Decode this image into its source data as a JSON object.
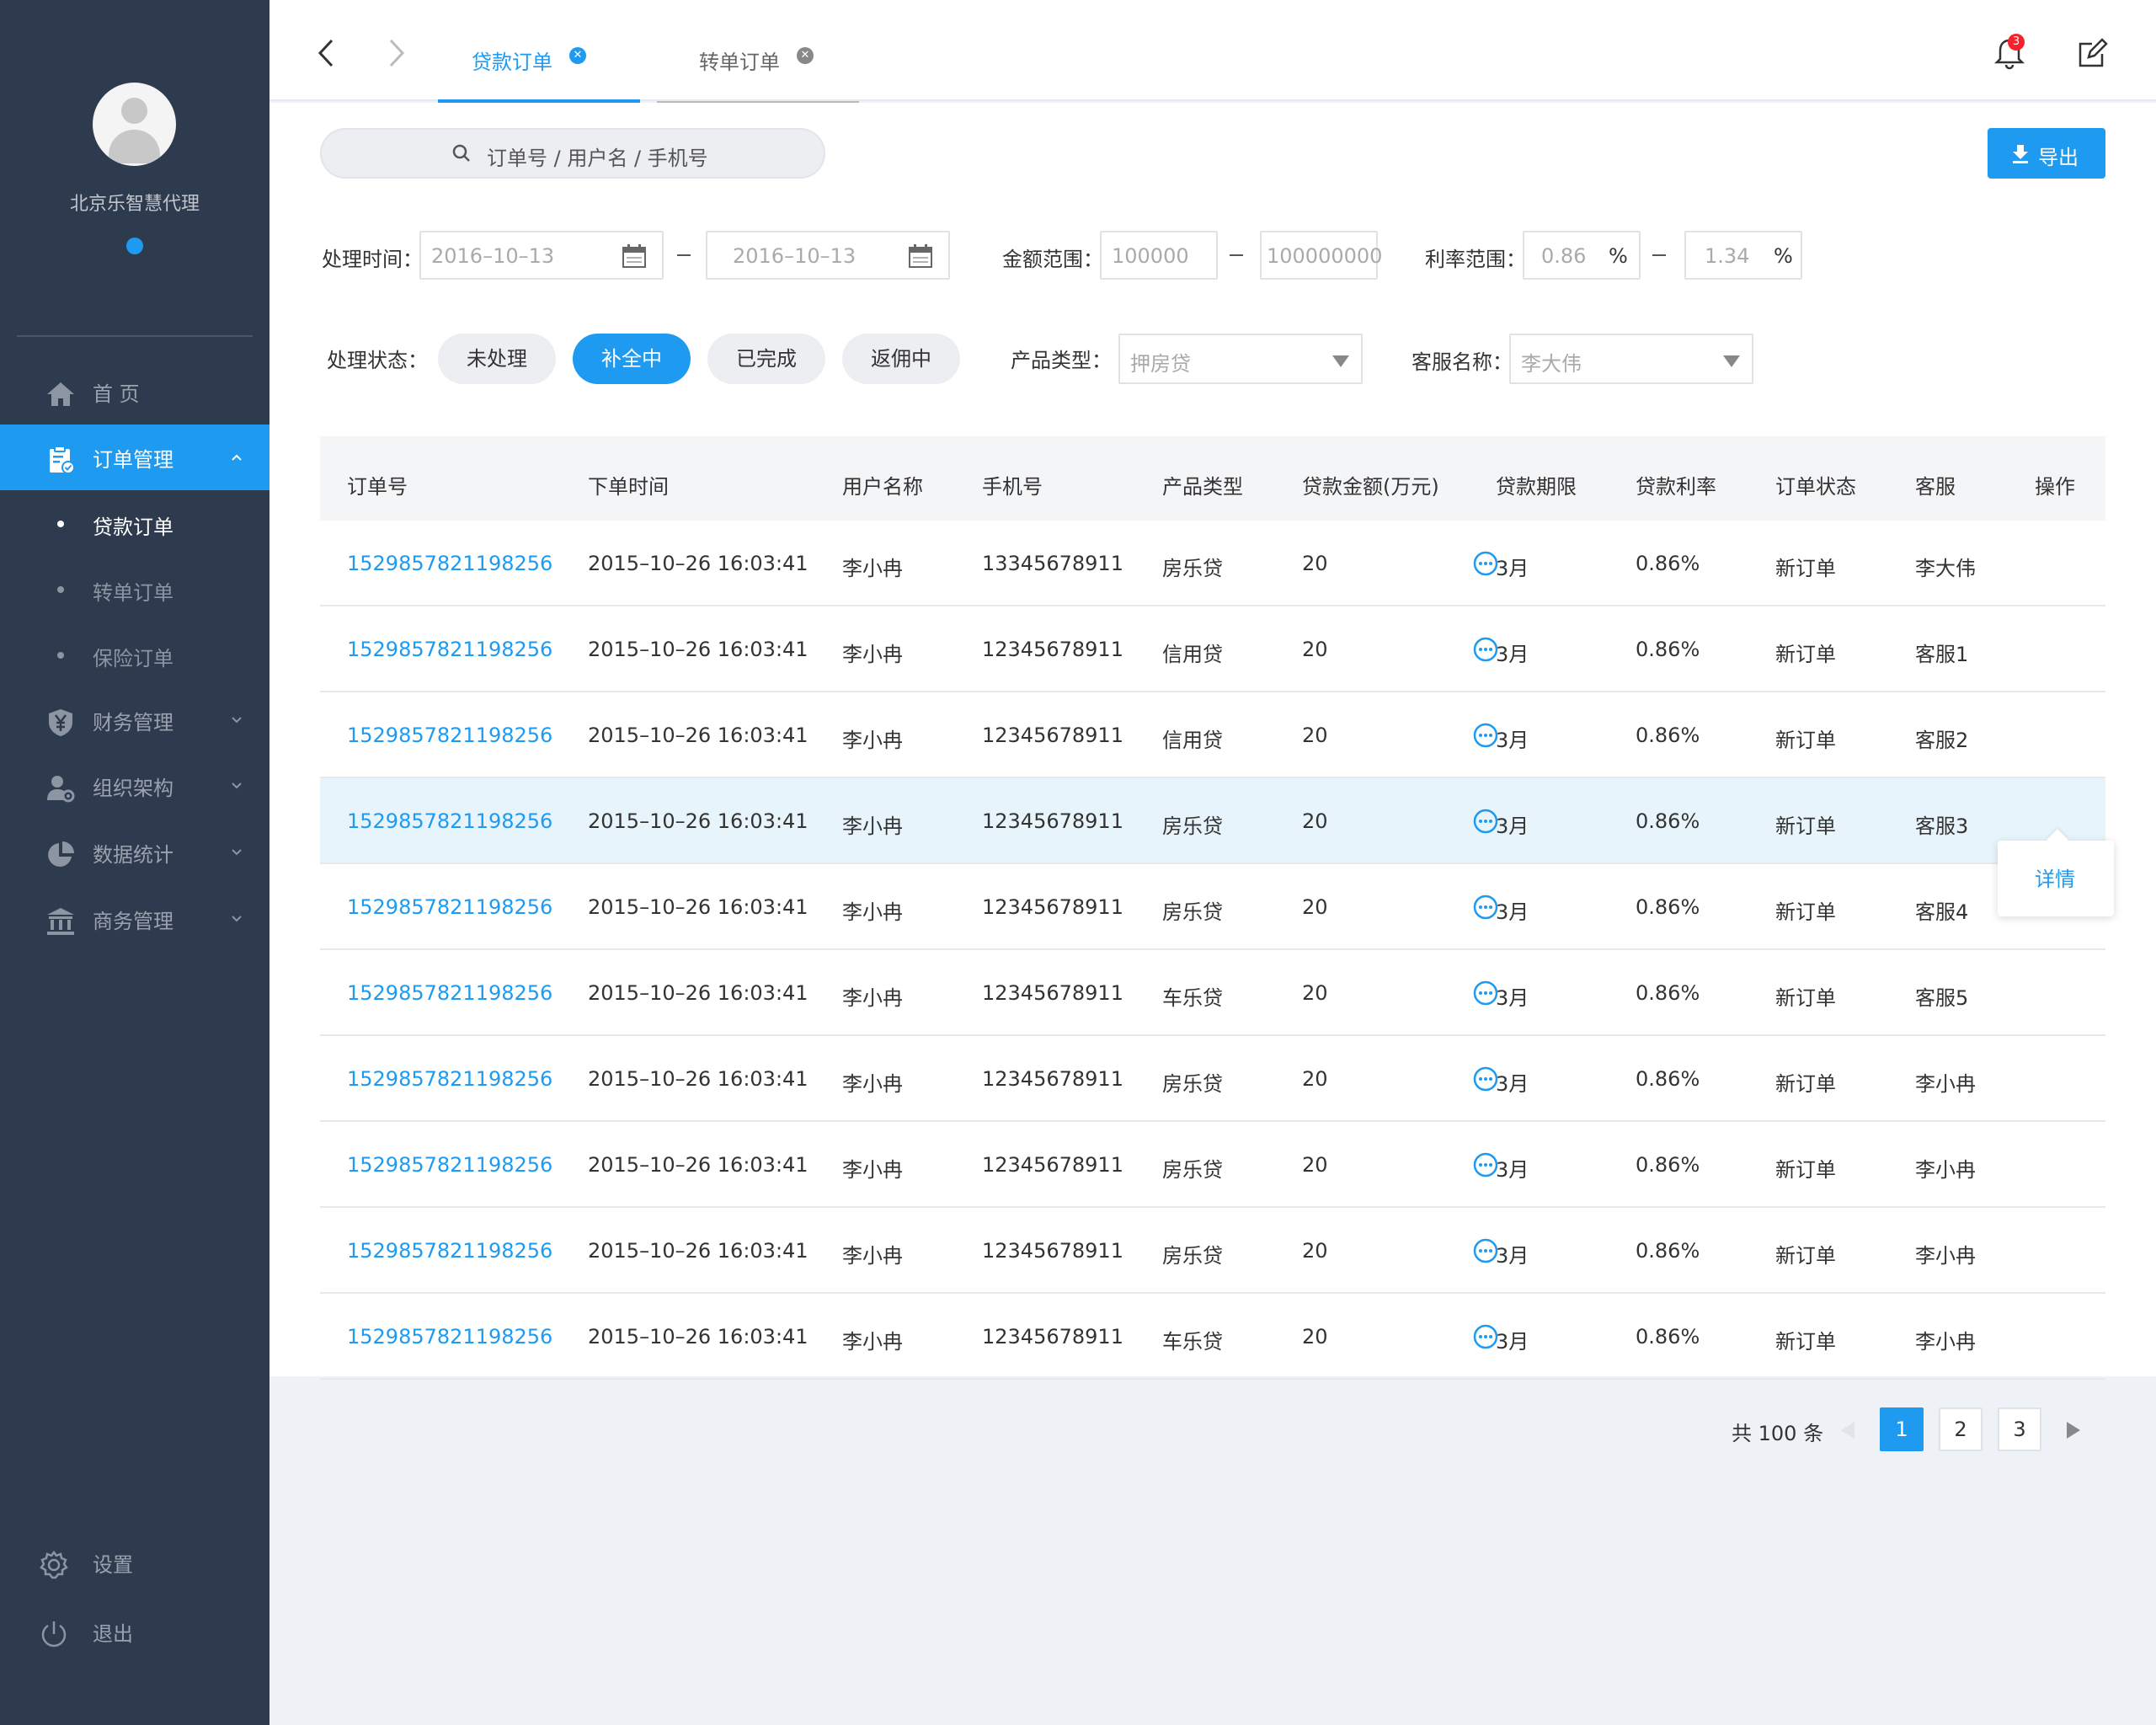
{
  "sidebar": {
    "agency_name": "北京乐智慧代理",
    "nav": {
      "home": "首 页",
      "orders": "订单管理",
      "sub_loan": "贷款订单",
      "sub_transfer": "转单订单",
      "sub_insurance": "保险订单",
      "finance": "财务管理",
      "org": "组织架构",
      "stats": "数据统计",
      "business": "商务管理",
      "settings": "设置",
      "logout": "退出"
    }
  },
  "topbar": {
    "tabs": [
      {
        "label": "贷款订单",
        "active": true
      },
      {
        "label": "转单订单",
        "active": false
      }
    ],
    "notification_count": "3"
  },
  "toolbar": {
    "search_placeholder": "订单号 / 用户名 / 手机号",
    "export_label": "导出"
  },
  "filters": {
    "time_label": "处理时间：",
    "date_from": "2016–10–13",
    "date_to": "2016–10–13",
    "amount_label": "金额范围：",
    "amount_min": "100000",
    "amount_max": "100000000",
    "rate_label": "利率范围：",
    "rate_min": "0.86",
    "rate_max": "1.34",
    "percent": "%",
    "status_label": "处理状态：",
    "statuses": [
      "未处理",
      "补全中",
      "已完成",
      "返佣中"
    ],
    "active_status": "补全中",
    "product_label": "产品类型：",
    "product_value": "押房贷",
    "agent_label": "客服名称：",
    "agent_value": "李大伟"
  },
  "table": {
    "headers": [
      "订单号",
      "下单时间",
      "用户名称",
      "手机号",
      "产品类型",
      "贷款金额(万元)",
      "贷款期限",
      "贷款利率",
      "订单状态",
      "客服",
      "操作"
    ],
    "rows": [
      [
        "1529857821198256",
        "2015–10–26 16:03:41",
        "李小冉",
        "13345678911",
        "房乐贷",
        "20",
        "3月",
        "0.86%",
        "新订单",
        "李大伟"
      ],
      [
        "1529857821198256",
        "2015–10–26 16:03:41",
        "李小冉",
        "12345678911",
        "信用贷",
        "20",
        "3月",
        "0.86%",
        "新订单",
        "客服1"
      ],
      [
        "1529857821198256",
        "2015–10–26 16:03:41",
        "李小冉",
        "12345678911",
        "信用贷",
        "20",
        "3月",
        "0.86%",
        "新订单",
        "客服2"
      ],
      [
        "1529857821198256",
        "2015–10–26 16:03:41",
        "李小冉",
        "12345678911",
        "房乐贷",
        "20",
        "3月",
        "0.86%",
        "新订单",
        "客服3"
      ],
      [
        "1529857821198256",
        "2015–10–26 16:03:41",
        "李小冉",
        "12345678911",
        "房乐贷",
        "20",
        "3月",
        "0.86%",
        "新订单",
        "客服4"
      ],
      [
        "1529857821198256",
        "2015–10–26 16:03:41",
        "李小冉",
        "12345678911",
        "车乐贷",
        "20",
        "3月",
        "0.86%",
        "新订单",
        "客服5"
      ],
      [
        "1529857821198256",
        "2015–10–26 16:03:41",
        "李小冉",
        "12345678911",
        "房乐贷",
        "20",
        "3月",
        "0.86%",
        "新订单",
        "李小冉"
      ],
      [
        "1529857821198256",
        "2015–10–26 16:03:41",
        "李小冉",
        "12345678911",
        "房乐贷",
        "20",
        "3月",
        "0.86%",
        "新订单",
        "李小冉"
      ],
      [
        "1529857821198256",
        "2015–10–26 16:03:41",
        "李小冉",
        "12345678911",
        "房乐贷",
        "20",
        "3月",
        "0.86%",
        "新订单",
        "李小冉"
      ],
      [
        "1529857821198256",
        "2015–10–26 16:03:41",
        "李小冉",
        "12345678911",
        "车乐贷",
        "20",
        "3月",
        "0.86%",
        "新订单",
        "李小冉"
      ]
    ],
    "highlighted_row": 3,
    "popover_label": "详情"
  },
  "pagination": {
    "total": "共 100 条",
    "pages": [
      "1",
      "2",
      "3"
    ],
    "current": "1"
  },
  "colors": {
    "accent": "#1e9af0",
    "sidebar_bg": "#2e3a4d",
    "badge": "#f5222d"
  }
}
